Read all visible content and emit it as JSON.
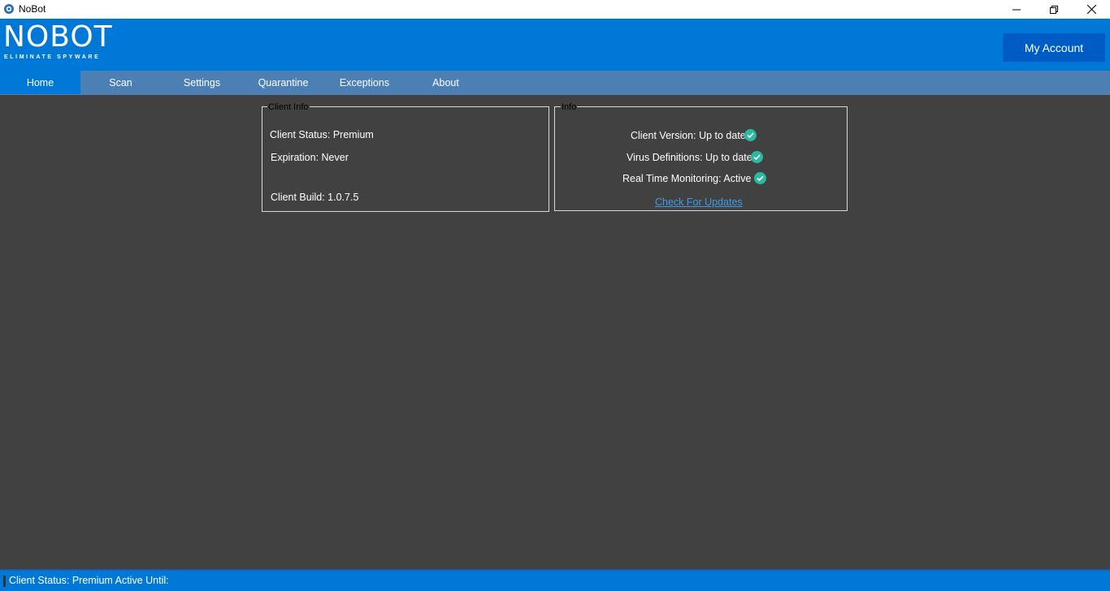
{
  "window": {
    "title": "NoBot"
  },
  "header": {
    "logo_text": "NOBOT",
    "logo_tagline": "ELIMINATE SPYWARE",
    "account_button": "My Account"
  },
  "nav": {
    "tabs": [
      {
        "label": "Home",
        "active": true
      },
      {
        "label": "Scan",
        "active": false
      },
      {
        "label": "Settings",
        "active": false
      },
      {
        "label": "Quarantine",
        "active": false
      },
      {
        "label": "Exceptions",
        "active": false
      },
      {
        "label": "About",
        "active": false
      }
    ]
  },
  "client_info": {
    "legend": "Client Info",
    "status": "Client Status: Premium",
    "expiration": "Expiration: Never",
    "build": "Client Build: 1.0.7.5"
  },
  "info": {
    "legend": "Info",
    "client_version": "Client Version: Up to date",
    "virus_definitions": "Virus Definitions: Up to date",
    "real_time_monitoring": "Real Time Monitoring: Active",
    "check_updates": "Check For Updates"
  },
  "statusbar": {
    "text": "Client Status: Premium Active Until:"
  },
  "colors": {
    "accent": "#0078d7",
    "nav": "#4c7fb4",
    "background": "#414141",
    "check": "#2db9a0",
    "link": "#3d9ce8"
  },
  "icons": {
    "app": "shield-logo-icon",
    "check": "check-circle-icon",
    "minimize": "minimize-icon",
    "maximize": "restore-icon",
    "close": "close-icon"
  }
}
